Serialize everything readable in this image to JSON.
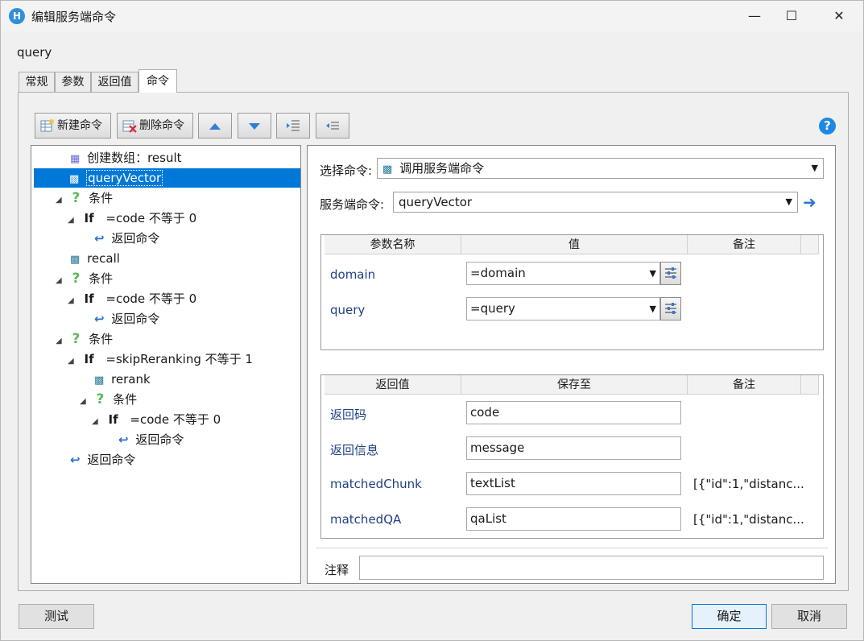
{
  "window": {
    "title": "编辑服务端命令"
  },
  "name_label": "query",
  "tabs": [
    {
      "label": "常规"
    },
    {
      "label": "参数"
    },
    {
      "label": "返回值"
    },
    {
      "label": "命令",
      "active": true
    }
  ],
  "toolbar": {
    "new_label": "新建命令",
    "delete_label": "删除命令"
  },
  "tree": [
    {
      "text": "创建数组：result",
      "icon": "array-icon"
    },
    {
      "text": "queryVector",
      "icon": "server-command-icon",
      "selected": true
    },
    {
      "text": "条件",
      "icon": "question-icon"
    },
    {
      "prefix": "If",
      "text": "=code 不等于 0"
    },
    {
      "text": "返回命令",
      "icon": "return-icon"
    },
    {
      "text": "recall",
      "icon": "server-command-icon"
    },
    {
      "text": "条件",
      "icon": "question-icon"
    },
    {
      "prefix": "If",
      "text": "=code 不等于 0"
    },
    {
      "text": "返回命令",
      "icon": "return-icon"
    },
    {
      "text": "条件",
      "icon": "question-icon"
    },
    {
      "prefix": "If",
      "text": "=skipReranking 不等于 1"
    },
    {
      "text": "rerank",
      "icon": "server-command-icon"
    },
    {
      "text": "条件",
      "icon": "question-icon"
    },
    {
      "prefix": "If",
      "text": "=code 不等于 0"
    },
    {
      "text": "返回命令",
      "icon": "return-icon"
    },
    {
      "text": "返回命令",
      "icon": "return-icon"
    }
  ],
  "detail": {
    "select_cmd_label": "选择命令:",
    "select_cmd_value": "调用服务端命令",
    "server_cmd_label": "服务端命令:",
    "server_cmd_value": "queryVector",
    "params_headers": [
      "参数名称",
      "值",
      "备注"
    ],
    "params": [
      {
        "name": "domain",
        "value": "=domain"
      },
      {
        "name": "query",
        "value": "=query"
      }
    ],
    "returns_headers": [
      "返回值",
      "保存至",
      "备注"
    ],
    "returns": [
      {
        "name": "返回码",
        "value": "code",
        "note": ""
      },
      {
        "name": "返回信息",
        "value": "message",
        "note": ""
      },
      {
        "name": "matchedChunk",
        "value": "textList",
        "note": "[{\"id\":1,\"distanc..."
      },
      {
        "name": "matchedQA",
        "value": "qaList",
        "note": "[{\"id\":1,\"distanc..."
      }
    ],
    "comment_label": "注释",
    "comment_value": ""
  },
  "buttons": {
    "test": "测试",
    "ok": "确定",
    "cancel": "取消"
  },
  "colors": {
    "accent": "#0078d7",
    "param_name": "#1f3f86",
    "help": "#1e88e5"
  }
}
